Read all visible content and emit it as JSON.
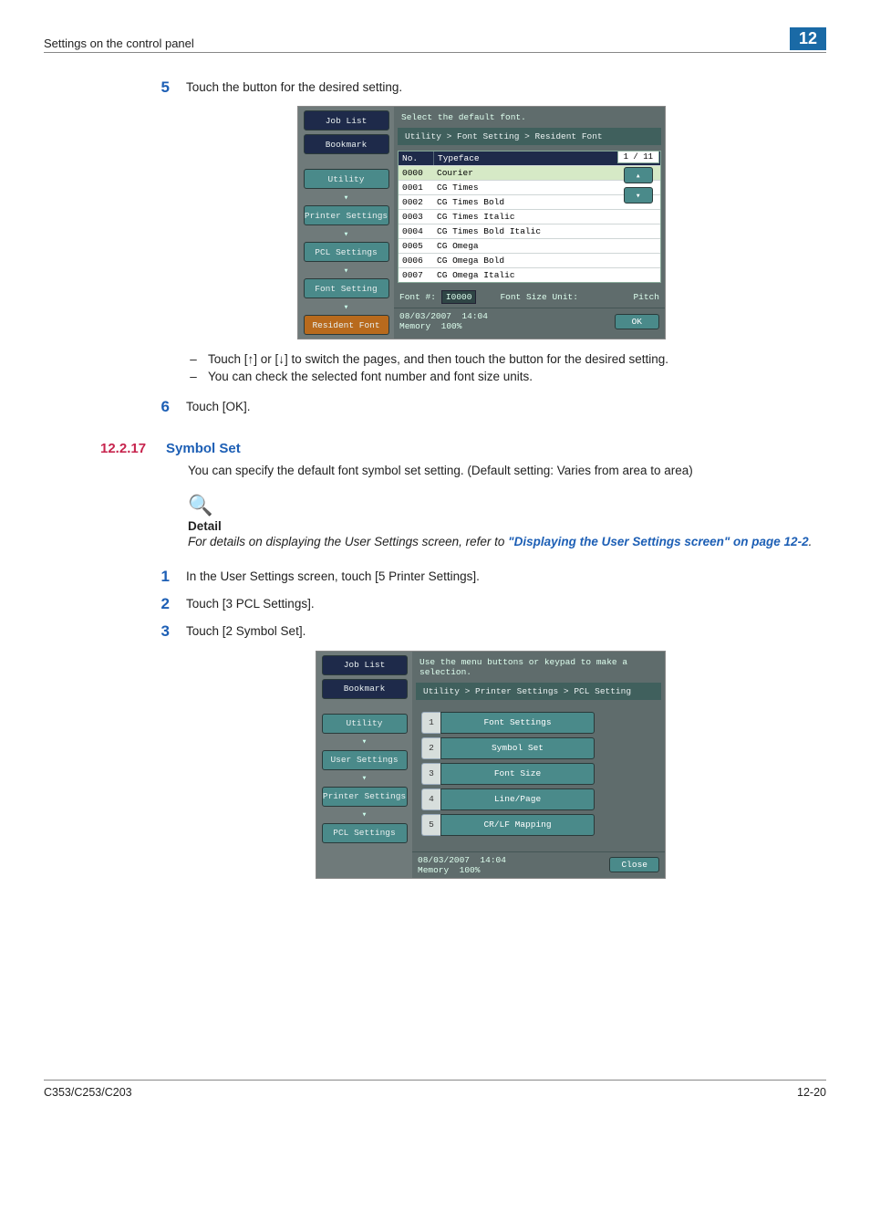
{
  "header": {
    "title": "Settings on the control panel",
    "chapter": "12"
  },
  "step5": {
    "num": "5",
    "text": "Touch the button for the desired setting."
  },
  "panel1": {
    "side": {
      "joblist": "Job List",
      "bookmark": "Bookmark",
      "utility": "Utility",
      "printer": "Printer Settings",
      "pcl": "PCL Settings",
      "font": "Font Setting",
      "resident": "Resident Font"
    },
    "title": "Select the default font.",
    "crumb": "Utility > Font Setting > Resident Font",
    "headNo": "No.",
    "headType": "Typeface",
    "rows": [
      {
        "no": "0000",
        "name": "Courier"
      },
      {
        "no": "0001",
        "name": "CG Times"
      },
      {
        "no": "0002",
        "name": "CG Times Bold"
      },
      {
        "no": "0003",
        "name": "CG Times Italic"
      },
      {
        "no": "0004",
        "name": "CG Times Bold Italic"
      },
      {
        "no": "0005",
        "name": "CG Omega"
      },
      {
        "no": "0006",
        "name": "CG Omega Bold"
      },
      {
        "no": "0007",
        "name": "CG Omega Italic"
      }
    ],
    "pageind": "1 / 11",
    "foot": {
      "fontnoLabel": "Font #:",
      "fontnoVal": "I0000",
      "unitLabel": "Font Size Unit:",
      "unitVal": "Pitch"
    },
    "status": {
      "date": "08/03/2007",
      "time": "14:04",
      "memLabel": "Memory",
      "memVal": "100%",
      "ok": "OK"
    }
  },
  "bullets": {
    "b1": "Touch [↑] or [↓] to switch the pages, and then touch the button for the desired setting.",
    "b2": "You can check the selected font number and font size units."
  },
  "step6": {
    "num": "6",
    "text": "Touch [OK]."
  },
  "section": {
    "num": "12.2.17",
    "title": "Symbol Set"
  },
  "sec_p": "You can specify the default font symbol set setting. (Default setting: Varies from area to area)",
  "note": {
    "label": "Detail",
    "body1": "For details on displaying the User Settings screen, refer to ",
    "link": "\"Displaying the User Settings screen\" on page 12-2",
    "body2": "."
  },
  "steps2": {
    "s1": {
      "num": "1",
      "text": "In the User Settings screen, touch [5 Printer Settings]."
    },
    "s2": {
      "num": "2",
      "text": "Touch [3 PCL Settings]."
    },
    "s3": {
      "num": "3",
      "text": "Touch [2 Symbol Set]."
    }
  },
  "panel2": {
    "side": {
      "joblist": "Job List",
      "bookmark": "Bookmark",
      "utility": "Utility",
      "user": "User Settings",
      "printer": "Printer Settings",
      "pcl": "PCL Settings"
    },
    "title": "Use the menu buttons or keypad to make a selection.",
    "crumb": "Utility > Printer Settings > PCL Setting",
    "menu": [
      {
        "n": "1",
        "l": "Font Settings"
      },
      {
        "n": "2",
        "l": "Symbol Set"
      },
      {
        "n": "3",
        "l": "Font Size"
      },
      {
        "n": "4",
        "l": "Line/Page"
      },
      {
        "n": "5",
        "l": "CR/LF Mapping"
      }
    ],
    "status": {
      "date": "08/03/2007",
      "time": "14:04",
      "memLabel": "Memory",
      "memVal": "100%",
      "close": "Close"
    }
  },
  "footer": {
    "left": "C353/C253/C203",
    "right": "12-20"
  }
}
